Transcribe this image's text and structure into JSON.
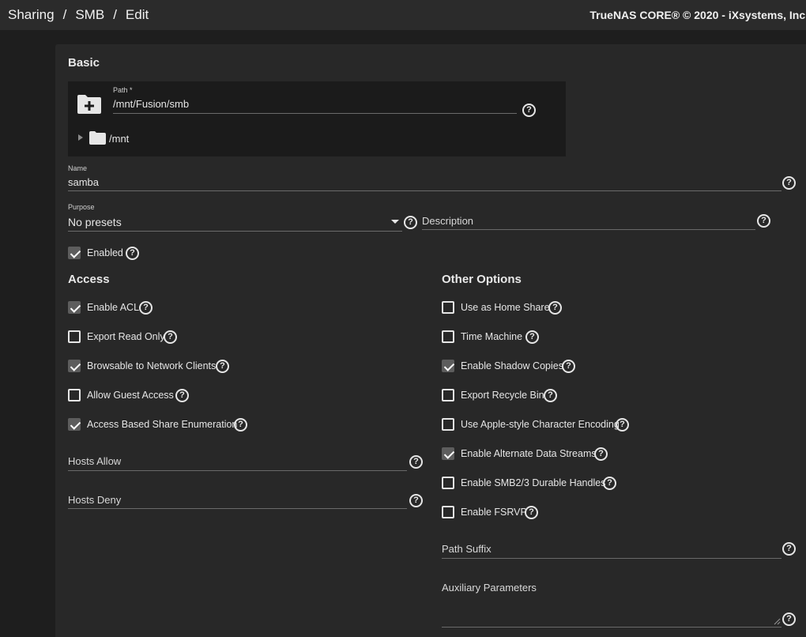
{
  "header": {
    "breadcrumb": [
      "Sharing",
      "SMB",
      "Edit"
    ],
    "copyright": "TrueNAS CORE® © 2020 - iXsystems, Inc."
  },
  "basic": {
    "title": "Basic",
    "path": {
      "label": "Path *",
      "value": "/mnt/Fusion/smb",
      "tree_root": "/mnt"
    },
    "name": {
      "label": "Name",
      "value": "samba"
    },
    "purpose": {
      "label": "Purpose",
      "value": "No presets"
    },
    "description": {
      "placeholder": "Description",
      "value": ""
    },
    "enabled": {
      "label": "Enabled",
      "checked": true
    }
  },
  "access": {
    "title": "Access",
    "options": [
      {
        "label": "Enable ACL",
        "checked": true
      },
      {
        "label": "Export Read Only",
        "checked": false
      },
      {
        "label": "Browsable to Network Clients",
        "checked": true
      },
      {
        "label": "Allow Guest Access",
        "checked": false
      },
      {
        "label": "Access Based Share Enumeration",
        "checked": true
      }
    ],
    "hosts_allow": {
      "placeholder": "Hosts Allow",
      "value": ""
    },
    "hosts_deny": {
      "placeholder": "Hosts Deny",
      "value": ""
    }
  },
  "other": {
    "title": "Other Options",
    "options": [
      {
        "label": "Use as Home Share",
        "checked": false
      },
      {
        "label": "Time Machine",
        "checked": false
      },
      {
        "label": "Enable Shadow Copies",
        "checked": true
      },
      {
        "label": "Export Recycle Bin",
        "checked": false
      },
      {
        "label": "Use Apple-style Character Encoding",
        "checked": false
      },
      {
        "label": "Enable Alternate Data Streams",
        "checked": true
      },
      {
        "label": "Enable SMB2/3 Durable Handles",
        "checked": false
      },
      {
        "label": "Enable FSRVP",
        "checked": false
      }
    ],
    "path_suffix": {
      "placeholder": "Path Suffix",
      "value": ""
    },
    "aux_params": {
      "placeholder": "Auxiliary Parameters",
      "value": ""
    }
  },
  "help_glyph": "?",
  "icons": [
    "folder-add-icon",
    "folder-icon",
    "expand-arrow-icon",
    "help-icon",
    "dropdown-arrow-icon",
    "check-icon"
  ],
  "colors": {
    "background": "#1e1e1e",
    "card": "#282828",
    "topbar": "#2b2b2b",
    "checkbox_checked": "#5d5d5d"
  }
}
